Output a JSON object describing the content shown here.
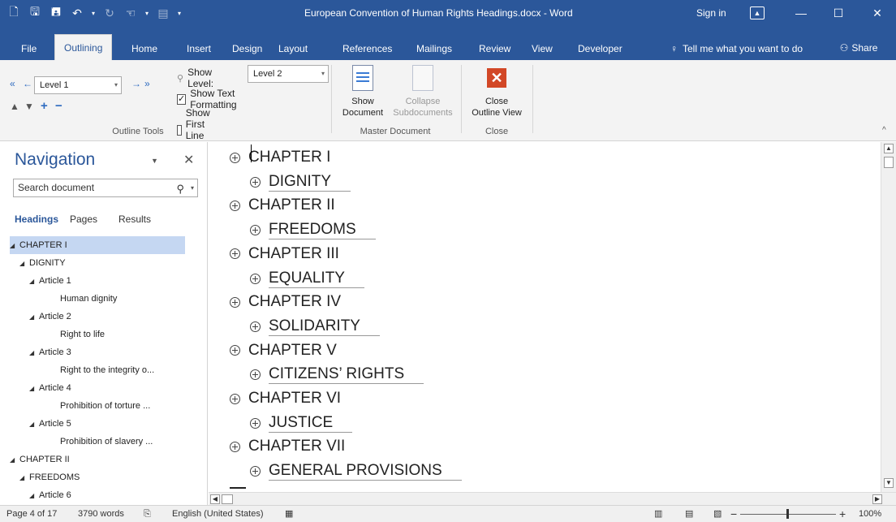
{
  "window": {
    "title": "European Convention of Human Rights Headings.docx - Word",
    "sign_in": "Sign in",
    "minimize_glyph": "—",
    "maximize_glyph": "☐",
    "close_glyph": "✕"
  },
  "tabs": {
    "file": "File",
    "outlining": "Outlining",
    "home": "Home",
    "insert": "Insert",
    "design": "Design",
    "layout": "Layout",
    "references": "References",
    "mailings": "Mailings",
    "review": "Review",
    "view": "View",
    "developer": "Developer",
    "tell_me": "Tell me what you want to do",
    "share": "Share"
  },
  "ribbon": {
    "outline_tools": {
      "level_value": "Level 1",
      "show_level_label": "Show Level:",
      "show_level_value": "Level 2",
      "show_text_formatting": "Show Text Formatting",
      "show_text_formatting_checked": true,
      "show_first_line_only": "Show First Line Only",
      "show_first_line_only_checked": false,
      "group_label": "Outline Tools"
    },
    "master_document": {
      "show_document_line1": "Show",
      "show_document_line2": "Document",
      "collapse_line1": "Collapse",
      "collapse_line2": "Subdocuments",
      "group_label": "Master Document"
    },
    "close": {
      "close_line1": "Close",
      "close_line2": "Outline View",
      "group_label": "Close"
    }
  },
  "navigation": {
    "title": "Navigation",
    "search_placeholder": "Search document",
    "tabs": [
      "Headings",
      "Pages",
      "Results"
    ],
    "tree": [
      {
        "label": "CHAPTER I",
        "level": 0,
        "expanded": true,
        "selected": true
      },
      {
        "label": "DIGNITY",
        "level": 1,
        "expanded": true
      },
      {
        "label": "Article 1",
        "level": 2,
        "expanded": true
      },
      {
        "label": "Human dignity",
        "level": 3
      },
      {
        "label": "Article 2",
        "level": 2,
        "expanded": true
      },
      {
        "label": "Right to life",
        "level": 3
      },
      {
        "label": "Article 3",
        "level": 2,
        "expanded": true
      },
      {
        "label": "Right to the integrity o...",
        "level": 3
      },
      {
        "label": "Article 4",
        "level": 2,
        "expanded": true
      },
      {
        "label": "Prohibition of torture ...",
        "level": 3
      },
      {
        "label": "Article 5",
        "level": 2,
        "expanded": true
      },
      {
        "label": "Prohibition of slavery ...",
        "level": 3
      },
      {
        "label": "CHAPTER II",
        "level": 0,
        "expanded": true
      },
      {
        "label": "FREEDOMS",
        "level": 1,
        "expanded": true
      },
      {
        "label": "Article 6",
        "level": 2,
        "expanded": true
      }
    ]
  },
  "outline": [
    {
      "text": "CHAPTER I",
      "level": 1
    },
    {
      "text": "DIGNITY",
      "level": 2
    },
    {
      "text": "CHAPTER II",
      "level": 1
    },
    {
      "text": "FREEDOMS",
      "level": 2
    },
    {
      "text": "CHAPTER III",
      "level": 1
    },
    {
      "text": "EQUALITY",
      "level": 2
    },
    {
      "text": "CHAPTER IV",
      "level": 1
    },
    {
      "text": "SOLIDARITY",
      "level": 2
    },
    {
      "text": "CHAPTER V",
      "level": 1
    },
    {
      "text": "CITIZENS’ RIGHTS",
      "level": 2
    },
    {
      "text": "CHAPTER VI",
      "level": 1
    },
    {
      "text": "JUSTICE",
      "level": 2
    },
    {
      "text": "CHAPTER VII",
      "level": 1
    },
    {
      "text": "GENERAL PROVISIONS",
      "level": 2
    }
  ],
  "status": {
    "page": "Page 4 of 17",
    "words": "3790 words",
    "language": "English (United States)",
    "zoom": "100%",
    "zoom_minus": "−",
    "zoom_plus": "+"
  },
  "colors": {
    "accent": "#2b579a",
    "close_red": "#d24726",
    "selection": "#c5d7f2"
  }
}
